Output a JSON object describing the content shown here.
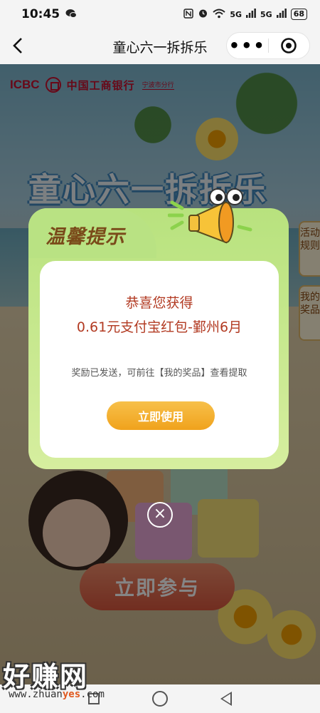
{
  "status_bar": {
    "time": "10:45",
    "network_1": "5G",
    "network_2": "5G",
    "battery": "68"
  },
  "header": {
    "back_glyph": "<",
    "title": "童心六一拆拆乐",
    "more_glyph": "•••"
  },
  "background": {
    "bank_abbr": "ICBC",
    "bank_name": "中国工商银行",
    "bank_branch": "宁波市分行",
    "banner_title": "童心六一拆拆乐",
    "side_tab_rules": "活动规则",
    "side_tab_prizes": "我的奖品",
    "join_button": "立即参与"
  },
  "modal": {
    "heading": "温馨提示",
    "congrats": "恭喜您获得",
    "prize": "0.61元支付宝红包-鄞州6月",
    "notice": "奖励已发送，可前往【我的奖品】查看提取",
    "use_button": "立即使用",
    "close_glyph": "×"
  },
  "watermark": {
    "text": "好赚网",
    "url_prefix": "www.zhuan",
    "url_highlight": "yes",
    "url_suffix": ".com"
  },
  "colors": {
    "modal_green": "#b8e27e",
    "button_orange": "#f0a21c",
    "prize_red": "#b23a22",
    "bank_red": "#c8102e"
  }
}
